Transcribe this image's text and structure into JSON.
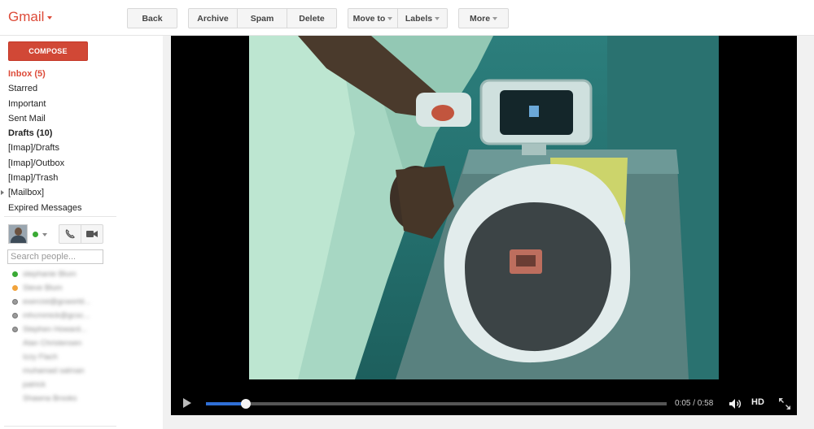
{
  "app": {
    "brand": "Gmail"
  },
  "toolbar": {
    "back": "Back",
    "archive": "Archive",
    "spam": "Spam",
    "delete": "Delete",
    "move_to": "Move to",
    "labels": "Labels",
    "more": "More"
  },
  "sidebar": {
    "compose": "COMPOSE",
    "items": [
      {
        "label": "Inbox (5)"
      },
      {
        "label": "Starred"
      },
      {
        "label": "Important"
      },
      {
        "label": "Sent Mail"
      },
      {
        "label": "Drafts (10)"
      },
      {
        "label": "[Imap]/Drafts"
      },
      {
        "label": "[Imap]/Outbox"
      },
      {
        "label": "[Imap]/Trash"
      },
      {
        "label": "[Mailbox]"
      },
      {
        "label": "Expired Messages"
      }
    ]
  },
  "chat": {
    "search_placeholder": "Search people...",
    "status": "available",
    "contacts": [
      {
        "name": "stephanie Blum",
        "status": "available"
      },
      {
        "name": "Steve Blum",
        "status": "idle"
      },
      {
        "name": "exercist@gcworld...",
        "status": "offline"
      },
      {
        "name": "mhcmmick@gcsc...",
        "status": "offline"
      },
      {
        "name": "Stephen Howard...",
        "status": "offline"
      },
      {
        "name": "Alan Christensen",
        "status": "none"
      },
      {
        "name": "Izzy Flach",
        "status": "none"
      },
      {
        "name": "muhamad salman",
        "status": "none"
      },
      {
        "name": "patrick",
        "status": "none"
      },
      {
        "name": "Shawna Brooks",
        "status": "none"
      }
    ]
  },
  "player": {
    "time": "0:05 / 0:58",
    "hd": "HD",
    "progress": 0.0862,
    "progress_color": "#2f6fd6",
    "icons": [
      "play-icon",
      "volume-icon",
      "fullscreen-icon"
    ]
  },
  "colors": {
    "brand": "#dd4b39",
    "compose": "#d14836"
  }
}
